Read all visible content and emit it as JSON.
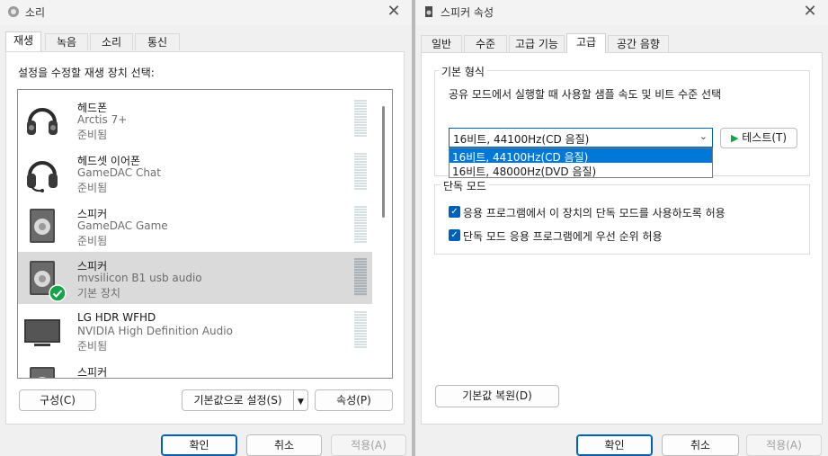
{
  "sound": {
    "title": "소리",
    "tabs": [
      "재생",
      "녹음",
      "소리",
      "통신"
    ],
    "instruction": "설정을 수정할 재생 장치 선택:",
    "devices": [
      {
        "name": "헤드폰",
        "sub": "Arctis 7+",
        "status": "준비됨",
        "icon": "headphones-icon"
      },
      {
        "name": "헤드셋 이어폰",
        "sub": "GameDAC Chat",
        "status": "준비됨",
        "icon": "headset-icon"
      },
      {
        "name": "스피커",
        "sub": "GameDAC Game",
        "status": "준비됨",
        "icon": "speaker-icon"
      },
      {
        "name": "스피커",
        "sub": "mvsilicon B1 usb audio",
        "status": "기본 장치",
        "icon": "speaker-icon"
      },
      {
        "name": "LG HDR WFHD",
        "sub": "NVIDIA High Definition Audio",
        "status": "준비됨",
        "icon": "monitor-icon"
      },
      {
        "name": "스피커",
        "sub": "",
        "status": "",
        "icon": "speaker-icon"
      }
    ],
    "buttons": {
      "configure": "구성(C)",
      "set_default": "기본값으로 설정(S)",
      "properties": "속성(P)",
      "ok": "확인",
      "cancel": "취소",
      "apply": "적용(A)"
    }
  },
  "speaker_props": {
    "title": "스피커 속성",
    "tabs": [
      "일반",
      "수준",
      "고급 기능",
      "고급",
      "공간 음향"
    ],
    "default_format": {
      "label": "기본 형식",
      "description": "공유 모드에서 실행할 때 사용할 샘플 속도 및 비트 수준 선택",
      "selected": "16비트, 44100Hz(CD 음질)",
      "options": [
        "16비트, 44100Hz(CD 음질)",
        "16비트, 48000Hz(DVD 음질)"
      ],
      "test_button": "테스트(T)"
    },
    "exclusive": {
      "label": "단독 모드",
      "options": [
        {
          "label": "응용 프로그램에서 이 장치의 단독 모드를 사용하도록 허용",
          "checked": true
        },
        {
          "label": "단독 모드 응용 프로그램에게 우선 순위 허용",
          "checked": true
        }
      ]
    },
    "buttons": {
      "restore": "기본값 복원(D)",
      "ok": "확인",
      "cancel": "취소",
      "apply": "적용(A)"
    }
  },
  "colors": {
    "accent": "#005fb8",
    "selection": "#0078d7",
    "check": "#16a34a"
  }
}
